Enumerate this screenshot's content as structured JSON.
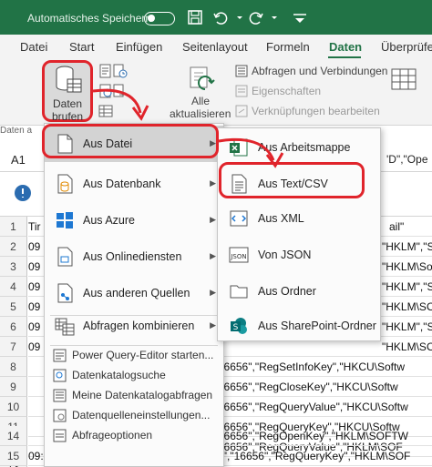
{
  "titlebar": {
    "autosave_label": "Automatisches Speichern"
  },
  "tabs": [
    "Datei",
    "Start",
    "Einfügen",
    "Seitenlayout",
    "Formeln",
    "Daten",
    "Überprüfe"
  ],
  "ribbon": {
    "daten_label_1": "Daten",
    "daten_label_2": "brufen",
    "alle_label_1": "Alle",
    "alle_label_2": "aktualisieren",
    "queries": "Abfragen und Verbindungen",
    "properties": "Eigenschaften",
    "edit_links": "Verknüpfungen bearbeiten",
    "group_label": "Daten a"
  },
  "formula_bar": {
    "name_box": "A1",
    "fragment": "'D\",\"Ope"
  },
  "grid": {
    "row_numbers": [
      "1",
      "2",
      "3",
      "4",
      "5",
      "6",
      "7",
      "8",
      "9",
      "10",
      "11",
      "12",
      "13",
      "14",
      "15"
    ],
    "row1_left": "Tir",
    "row1_right": "ail\"",
    "visible_fragments": [
      "09",
      "09",
      "09",
      "09",
      "09",
      "09",
      "09",
      "09",
      "09",
      "09"
    ],
    "fragments_right": [
      "\"HKLM\",\"SUC",
      "\"HKLM\\Softw",
      "\"HKLM\",\"SUC",
      "\"HKLM\\SOF",
      "\"HKLM\",\"SUC",
      "\"HKLM\\SOF",
      "\"HKLM\",\"SUC"
    ],
    "row10": "\",\"16656\",\"RegSetInfoKey\",\"HKCU\\Softw",
    "row11": "\",\"16656\",\"RegCloseKey\",\"HKCU\\Softw",
    "row12": "\",\"16656\",\"RegQueryValue\",\"HKCU\\Softw",
    "row13": "\",\"16656\",\"RegQueryKey\",\"HKCU\\Softw",
    "row14": "\",\"16656\",\"RegQueryValue\",\"HKLM\\SOF",
    "row15": "\",\"16656\",\"RegOpenKey\",\"HKLM\\SOFTW",
    "row16": "09:13:18,0129894,\"winrar-x64-561d.exe\",\"16656\",\"RegQueryKey\",\"HKLM\\SOF"
  },
  "main_menu": {
    "items": [
      "Aus Datei",
      "Aus Datenbank",
      "Aus Azure",
      "Aus Onlinediensten",
      "Aus anderen Quellen",
      "Abfragen kombinieren"
    ],
    "small_items": [
      "Power Query-Editor starten...",
      "Datenkatalogsuche",
      "Meine Datenkatalogabfragen",
      "Datenquelleneinstellungen...",
      "Abfrageoptionen"
    ]
  },
  "sub_menu": {
    "items": [
      "Aus Arbeitsmappe",
      "Aus Text/CSV",
      "Aus XML",
      "Von JSON",
      "Aus Ordner",
      "Aus SharePoint-Ordner"
    ]
  },
  "colors": {
    "excel_green": "#217346",
    "highlight_red": "#e0242b"
  }
}
